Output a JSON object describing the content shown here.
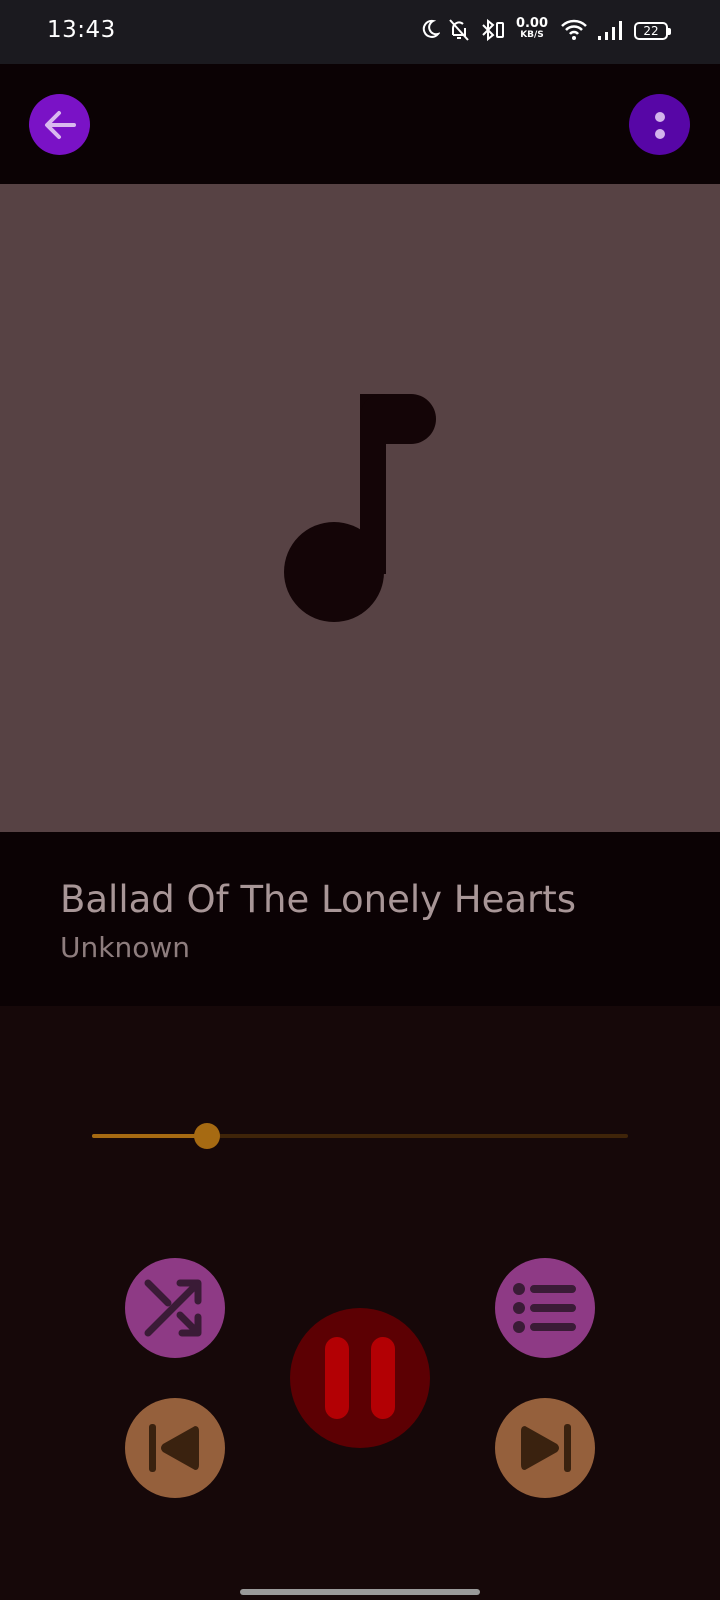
{
  "status_bar": {
    "time": "13:43",
    "net_speed_value": "0.00",
    "net_speed_unit": "KB/S",
    "battery_level": "22",
    "icons": [
      "moon-icon",
      "bell-off-icon",
      "bluetooth-icon",
      "wifi-icon",
      "signal-icon",
      "battery-icon"
    ]
  },
  "top_bar": {
    "back_icon": "arrow-left-icon",
    "menu_icon": "more-vertical-icon"
  },
  "now_playing": {
    "artwork_icon": "music-note-icon",
    "title": "Ballad Of The Lonely Hearts",
    "artist": "Unknown"
  },
  "seek_bar": {
    "progress": 0.215
  },
  "controls": {
    "shuffle_icon": "shuffle-icon",
    "queue_icon": "list-icon",
    "previous_icon": "skip-previous-icon",
    "play_pause_icon": "pause-icon",
    "next_icon": "skip-next-icon"
  },
  "colors": {
    "status_bg": "#1b1a1f",
    "header_bg": "#0b0204",
    "art_bg": "#574244",
    "player_bg": "#160809",
    "back_button": "#7a12c6",
    "menu_button": "#5706a6",
    "seek_accent": "#a66a12",
    "shuffle_queue": "#8e3a85",
    "prev_next": "#95603c",
    "play_pause": "#5c0003"
  }
}
